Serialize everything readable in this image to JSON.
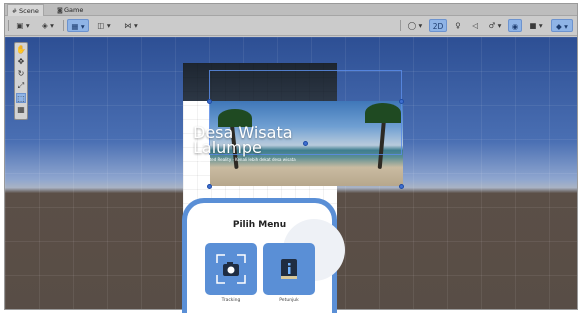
{
  "tabs": [
    {
      "label": "Scene",
      "icon": "hash-icon"
    },
    {
      "label": "Game",
      "icon": "gamepad-icon"
    }
  ],
  "toolbar": {
    "left": [
      {
        "name": "shading-mode",
        "glyph": "▣ ▾"
      },
      {
        "name": "render-mode",
        "glyph": "◈ ▾"
      },
      {
        "name": "gizmo-toggle",
        "glyph": "▦ ▾"
      },
      {
        "name": "draw-mode",
        "glyph": "◫ ▾"
      },
      {
        "name": "stats-toggle",
        "glyph": "⋈ ▾"
      }
    ],
    "right": [
      {
        "name": "visibility",
        "glyph": "◯ ▾"
      },
      {
        "name": "2d-toggle",
        "glyph": "2D"
      },
      {
        "name": "lighting",
        "glyph": "♀"
      },
      {
        "name": "audio",
        "glyph": "◁"
      },
      {
        "name": "effects",
        "glyph": "♂ ▾"
      },
      {
        "name": "hidden-objects",
        "glyph": "◉"
      },
      {
        "name": "camera",
        "glyph": "■ ▾"
      },
      {
        "name": "gizmos",
        "glyph": "◆ ▾"
      }
    ]
  },
  "tools": [
    "✋",
    "✥",
    "↻",
    "⤢",
    "⬚",
    "▦"
  ],
  "banner": {
    "title_line1": "Desa Wisata",
    "title_line2": "Lalumpe",
    "subtitle": "Augmented Reality · Kenali lebih dekat desa wisata"
  },
  "menu": {
    "title": "Pilih Menu",
    "buttons": [
      {
        "label": "Tracking",
        "icon": "camera-scan-icon"
      },
      {
        "label": "Petunjuk",
        "icon": "info-book-icon"
      }
    ]
  },
  "colors": {
    "accent": "#5a8fd6",
    "selection": "#8fb4e6",
    "sky_top": "#2d4f94",
    "ground": "#584d46"
  }
}
